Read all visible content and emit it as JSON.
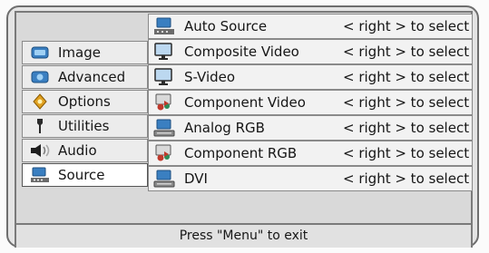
{
  "menu": {
    "nav_items": [
      {
        "label": "Image",
        "icon": "image-icon"
      },
      {
        "label": "Advanced",
        "icon": "advanced-icon"
      },
      {
        "label": "Options",
        "icon": "options-icon"
      },
      {
        "label": "Utilities",
        "icon": "utilities-icon"
      },
      {
        "label": "Audio",
        "icon": "speaker-icon"
      },
      {
        "label": "Source",
        "icon": "source-icon",
        "selected": true
      }
    ],
    "source_options": [
      {
        "label": "Auto Source",
        "hint": "< right > to select",
        "icon": "auto-source-icon"
      },
      {
        "label": "Composite Video",
        "hint": "< right > to select",
        "icon": "monitor-icon"
      },
      {
        "label": "S-Video",
        "hint": "< right > to select",
        "icon": "monitor-icon"
      },
      {
        "label": "Component Video",
        "hint": "< right > to select",
        "icon": "component-icon"
      },
      {
        "label": "Analog RGB",
        "hint": "< right > to select",
        "icon": "computer-icon"
      },
      {
        "label": "Component RGB",
        "hint": "< right > to select",
        "icon": "component-icon"
      },
      {
        "label": "DVI",
        "hint": "< right > to select",
        "icon": "computer-icon"
      }
    ],
    "footer": "Press \"Menu\" to exit"
  },
  "colors": {
    "frame_background": "#e4e4e4",
    "selected_tab": "#ffffff",
    "row_background": "#f2f2f2",
    "icon_blue": "#3a7fc1",
    "icon_red": "#c0392b"
  }
}
